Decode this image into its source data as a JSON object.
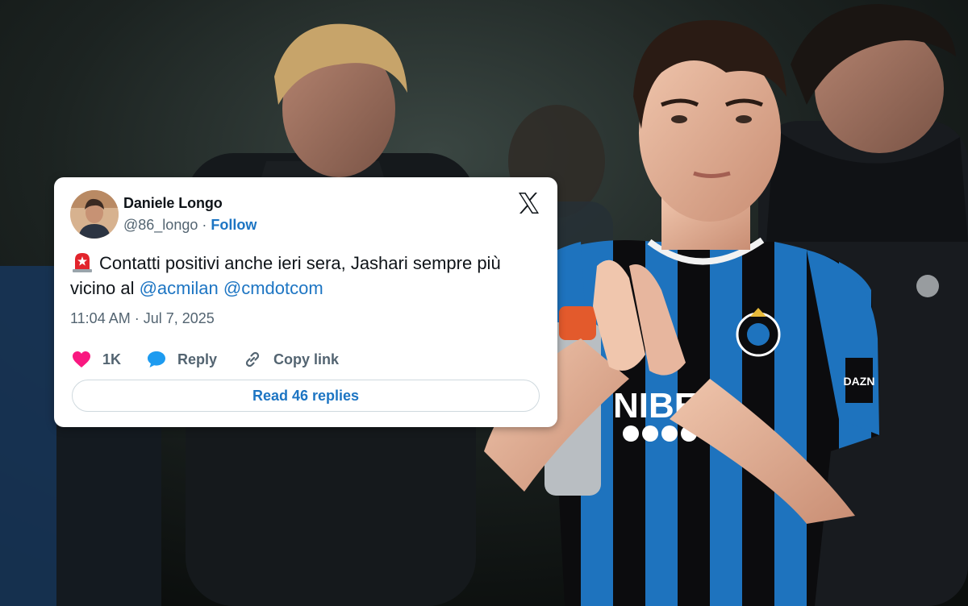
{
  "tweet": {
    "author_name": "Daniele Longo",
    "author_handle": "@86_longo",
    "separator": " · ",
    "follow_label": "Follow",
    "platform_icon": "x-logo-icon",
    "emoji_icon": "rotating-light-icon",
    "text_main": "Contatti positivi anche ieri sera, Jashari sempre più vicino al ",
    "mention_1": "@acmilan",
    "mention_2": "@cmdotcom",
    "timestamp": "11:04 AM · Jul 7, 2025",
    "likes_count": "1K",
    "reply_label": "Reply",
    "copy_link_label": "Copy link",
    "read_replies_label": "Read 46 replies"
  },
  "photo": {
    "subject": "football-player-photo",
    "kit_sponsor": "NIBE",
    "sleeve_logo": "DAZN"
  },
  "colors": {
    "link_blue": "#1d75c3",
    "like_pink": "#f91880",
    "text_dark": "#0f1419",
    "text_gray": "#536471",
    "kit_blue": "#1e73be",
    "kit_black": "#0c0c0e"
  }
}
